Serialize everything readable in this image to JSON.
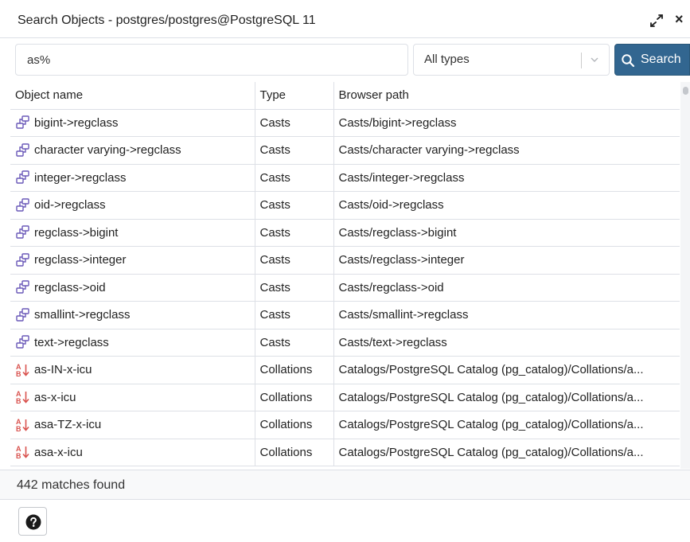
{
  "dialog": {
    "title": "Search Objects - postgres/postgres@PostgreSQL 11",
    "maximize_icon": "expand-arrows-icon",
    "close_icon": "close-icon",
    "close_glyph": "×"
  },
  "search": {
    "query": "as%",
    "type_filter": "All types",
    "button_label": "Search",
    "button_icon": "search-icon",
    "button_color": "#326690"
  },
  "table": {
    "columns": [
      "Object name",
      "Type",
      "Browser path"
    ],
    "rows": [
      {
        "name": "bigint->regclass",
        "type": "Casts",
        "path": "Casts/bigint->regclass",
        "icon": "cast-icon"
      },
      {
        "name": "character varying->regclass",
        "type": "Casts",
        "path": "Casts/character varying->regclass",
        "icon": "cast-icon"
      },
      {
        "name": "integer->regclass",
        "type": "Casts",
        "path": "Casts/integer->regclass",
        "icon": "cast-icon"
      },
      {
        "name": "oid->regclass",
        "type": "Casts",
        "path": "Casts/oid->regclass",
        "icon": "cast-icon"
      },
      {
        "name": "regclass->bigint",
        "type": "Casts",
        "path": "Casts/regclass->bigint",
        "icon": "cast-icon"
      },
      {
        "name": "regclass->integer",
        "type": "Casts",
        "path": "Casts/regclass->integer",
        "icon": "cast-icon"
      },
      {
        "name": "regclass->oid",
        "type": "Casts",
        "path": "Casts/regclass->oid",
        "icon": "cast-icon"
      },
      {
        "name": "smallint->regclass",
        "type": "Casts",
        "path": "Casts/smallint->regclass",
        "icon": "cast-icon"
      },
      {
        "name": "text->regclass",
        "type": "Casts",
        "path": "Casts/text->regclass",
        "icon": "cast-icon"
      },
      {
        "name": "as-IN-x-icu",
        "type": "Collations",
        "path": "Catalogs/PostgreSQL Catalog (pg_catalog)/Collations/a...",
        "icon": "collation-sort-icon"
      },
      {
        "name": "as-x-icu",
        "type": "Collations",
        "path": "Catalogs/PostgreSQL Catalog (pg_catalog)/Collations/a...",
        "icon": "collation-sort-icon"
      },
      {
        "name": "asa-TZ-x-icu",
        "type": "Collations",
        "path": "Catalogs/PostgreSQL Catalog (pg_catalog)/Collations/a...",
        "icon": "collation-sort-icon"
      },
      {
        "name": "asa-x-icu",
        "type": "Collations",
        "path": "Catalogs/PostgreSQL Catalog (pg_catalog)/Collations/a...",
        "icon": "collation-sort-icon"
      }
    ]
  },
  "status": {
    "matches": "442 matches found"
  },
  "footer": {
    "help_icon": "help-icon"
  }
}
